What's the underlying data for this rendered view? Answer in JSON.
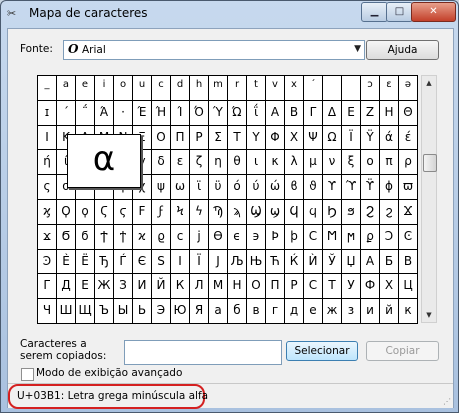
{
  "window": {
    "title": "Mapa de caracteres"
  },
  "font": {
    "label": "Fonte:",
    "selected": "Arial"
  },
  "buttons": {
    "help": "Ajuda",
    "select": "Selecionar",
    "copy": "Copiar"
  },
  "copy_field": {
    "label_line1": "Caracteres a",
    "label_line2": "serem copiados:",
    "value": ""
  },
  "advanced": {
    "label": "Modo de exibição avançado",
    "checked": false
  },
  "status": {
    "text": "U+03B1: Letra grega minúscula alfa"
  },
  "magnified": "α",
  "grid_rows": [
    [
      "_",
      "a",
      "e",
      "i",
      "o",
      "u",
      "c",
      "d",
      "h",
      "m",
      "r",
      "t",
      "v",
      "x",
      "´",
      "",
      "",
      "ɔ",
      "ɛ",
      "ə"
    ],
    [
      "ɪ",
      "΄",
      "΅",
      "Ά",
      "·",
      "Έ",
      "Ή",
      "Ί",
      "Ό",
      "Ύ",
      "Ώ",
      "ΐ",
      "Α",
      "Β",
      "Γ",
      "Δ",
      "Ε",
      "Ζ",
      "Η",
      "Θ"
    ],
    [
      "Ι",
      "Κ",
      "Λ",
      "Μ",
      "Ν",
      "Ξ",
      "Ο",
      "Π",
      "Ρ",
      "Σ",
      "Τ",
      "Υ",
      "Φ",
      "Χ",
      "Ψ",
      "Ω",
      "Ϊ",
      "Ϋ",
      "ά",
      "έ"
    ],
    [
      "ή",
      "ί",
      "ΰ",
      "α",
      "β",
      "γ",
      "δ",
      "ε",
      "ζ",
      "η",
      "θ",
      "ι",
      "κ",
      "λ",
      "μ",
      "ν",
      "ξ",
      "ο",
      "π",
      "ρ"
    ],
    [
      "ς",
      "σ",
      "τ",
      "υ",
      "φ",
      "χ",
      "ψ",
      "ω",
      "ϊ",
      "ϋ",
      "ό",
      "ύ",
      "ώ",
      "ϐ",
      "ϑ",
      "ϒ",
      "ϓ",
      "ϔ",
      "ϕ",
      "ϖ"
    ],
    [
      "ϗ",
      "Ϙ",
      "ϙ",
      "Ϛ",
      "ϛ",
      "Ϝ",
      "ϝ",
      "Ϟ",
      "ϟ",
      "Ϡ",
      "ϡ",
      "Ϣ",
      "ϣ",
      "Ϥ",
      "ϥ",
      "Ϧ",
      "ϧ",
      "Ϩ",
      "ϩ",
      "Ϫ"
    ],
    [
      "ϫ",
      "Ϭ",
      "ϭ",
      "Ϯ",
      "ϯ",
      "ϰ",
      "ϱ",
      "ϲ",
      "ϳ",
      "ϴ",
      "ϵ",
      "϶",
      "Ϸ",
      "ϸ",
      "Ϲ",
      "Ϻ",
      "ϻ",
      "ϼ",
      "Ͻ",
      "Ͼ"
    ],
    [
      "Ͽ",
      "Ѐ",
      "Ё",
      "Ђ",
      "Ѓ",
      "Є",
      "Ѕ",
      "І",
      "Ї",
      "Ј",
      "Љ",
      "Њ",
      "Ћ",
      "Ќ",
      "Ѝ",
      "Ў",
      "Џ",
      "А",
      "Б",
      "В"
    ],
    [
      "Г",
      "Д",
      "Е",
      "Ж",
      "З",
      "И",
      "Й",
      "К",
      "Л",
      "М",
      "Н",
      "О",
      "П",
      "Р",
      "С",
      "Т",
      "У",
      "Ф",
      "Х",
      "Ц"
    ],
    [
      "Ч",
      "Ш",
      "Щ",
      "Ъ",
      "Ы",
      "Ь",
      "Э",
      "Ю",
      "Я",
      "а",
      "б",
      "в",
      "г",
      "д",
      "е",
      "ж",
      "з",
      "и",
      "й",
      "к"
    ]
  ]
}
